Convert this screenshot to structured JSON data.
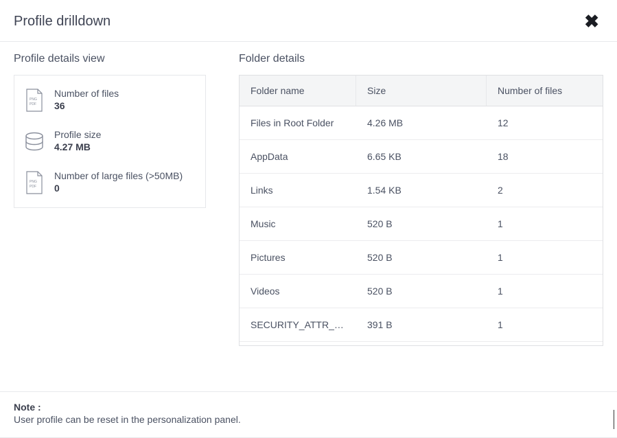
{
  "header": {
    "title": "Profile drilldown"
  },
  "profile_details": {
    "section_title": "Profile details view",
    "stats": [
      {
        "icon": "file",
        "label": "Number of files",
        "value": "36"
      },
      {
        "icon": "disk",
        "label": "Profile size",
        "value": "4.27 MB"
      },
      {
        "icon": "file",
        "label": "Number of large files (>50MB)",
        "value": "0"
      }
    ]
  },
  "folder_details": {
    "section_title": "Folder details",
    "columns": {
      "name": "Folder name",
      "size": "Size",
      "files": "Number of files"
    },
    "rows": [
      {
        "name": "Files in Root Folder",
        "size": "4.26 MB",
        "files": "12"
      },
      {
        "name": "AppData",
        "size": "6.65 KB",
        "files": "18"
      },
      {
        "name": "Links",
        "size": "1.54 KB",
        "files": "2"
      },
      {
        "name": "Music",
        "size": "520 B",
        "files": "1"
      },
      {
        "name": "Pictures",
        "size": "520 B",
        "files": "1"
      },
      {
        "name": "Videos",
        "size": "520 B",
        "files": "1"
      },
      {
        "name": "SECURITY_ATTR_TEMP",
        "size": "391 B",
        "files": "1"
      }
    ]
  },
  "footer": {
    "note_label": "Note :",
    "note_text": "User profile can be reset in the personalization panel."
  }
}
